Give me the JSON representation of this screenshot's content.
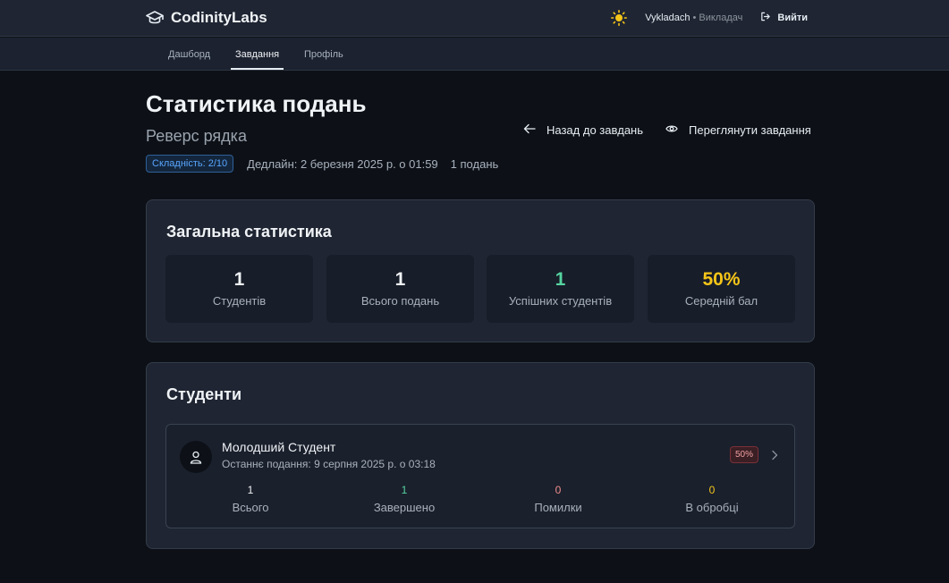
{
  "brand": {
    "name": "CodinityLabs",
    "icon": "graduation-cap-icon"
  },
  "user": {
    "name": "Vykladach",
    "separator": "•",
    "role": "Викладач"
  },
  "header": {
    "theme_icon": "sun-icon",
    "logout_label": "Вийти",
    "logout_icon": "logout-icon"
  },
  "nav": {
    "tabs": [
      {
        "label": "Дашборд",
        "active": false
      },
      {
        "label": "Завдання",
        "active": true
      },
      {
        "label": "Профіль",
        "active": false
      }
    ]
  },
  "page": {
    "title": "Статистика подань",
    "subtitle": "Реверс рядка",
    "difficulty": "Складність: 2/10",
    "deadline": "Дедлайн: 2 березня 2025 р. о 01:59",
    "submissions_count": "1 подань",
    "back_label": "Назад до завдань",
    "view_label": "Переглянути завдання"
  },
  "overall": {
    "title": "Загальна статистика",
    "stats": [
      {
        "value": "1",
        "label": "Студентів",
        "color": "#f0f3f6"
      },
      {
        "value": "1",
        "label": "Всього подань",
        "color": "#f0f3f6"
      },
      {
        "value": "1",
        "label": "Успішних студентів",
        "color": "#56d4a0"
      },
      {
        "value": "50%",
        "label": "Середній бал",
        "color": "#f5c518"
      }
    ]
  },
  "students": {
    "title": "Студенти",
    "items": [
      {
        "name": "Молодший Студент",
        "last_submission": "Останнє подання: 9 серпня 2025 р. о 03:18",
        "score": "50%",
        "stats": [
          {
            "value": "1",
            "label": "Всього",
            "color": "#f0f3f6"
          },
          {
            "value": "1",
            "label": "Завершено",
            "color": "#56d4a0"
          },
          {
            "value": "0",
            "label": "Помилки",
            "color": "#f08c8c"
          },
          {
            "value": "0",
            "label": "В обробці",
            "color": "#f5c518"
          }
        ]
      }
    ]
  }
}
